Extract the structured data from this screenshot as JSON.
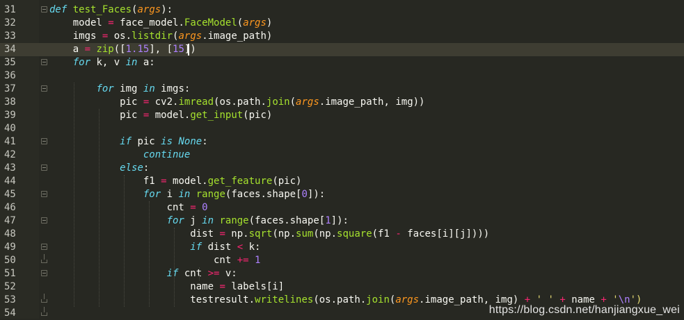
{
  "editor": {
    "theme_colors": {
      "background": "#272822",
      "current_line": "#3e3d32",
      "keyword": "#66d9ef",
      "function": "#a6e22e",
      "argument": "#fd971f",
      "number": "#ae81ff",
      "operator": "#f92672",
      "string": "#e6db74"
    },
    "lines": [
      {
        "n": "31",
        "segs": [
          [
            "kw",
            "def"
          ],
          [
            "t",
            " "
          ],
          [
            "fn",
            "test_Faces"
          ],
          [
            "t",
            "("
          ],
          [
            "arg",
            "args"
          ],
          [
            "t",
            "):"
          ]
        ]
      },
      {
        "n": "32",
        "segs": [
          [
            "t",
            "    model "
          ],
          [
            "op",
            "="
          ],
          [
            "t",
            " face_model."
          ],
          [
            "fn",
            "FaceModel"
          ],
          [
            "t",
            "("
          ],
          [
            "arg",
            "args"
          ],
          [
            "t",
            ")"
          ]
        ]
      },
      {
        "n": "33",
        "segs": [
          [
            "t",
            "    imgs "
          ],
          [
            "op",
            "="
          ],
          [
            "t",
            " os."
          ],
          [
            "fn",
            "listdir"
          ],
          [
            "t",
            "("
          ],
          [
            "arg",
            "args"
          ],
          [
            "t",
            ".image_path)"
          ]
        ]
      },
      {
        "n": "34",
        "segs": [
          [
            "t",
            "    a "
          ],
          [
            "op",
            "="
          ],
          [
            "t",
            " "
          ],
          [
            "fn",
            "zip"
          ],
          [
            "t",
            "(["
          ],
          [
            "num",
            "1.15"
          ],
          [
            "t",
            "], ["
          ],
          [
            "num",
            "15"
          ],
          [
            "t",
            "])"
          ]
        ]
      },
      {
        "n": "35",
        "segs": [
          [
            "t",
            "    "
          ],
          [
            "kw",
            "for"
          ],
          [
            "t",
            " k, v "
          ],
          [
            "kw",
            "in"
          ],
          [
            "t",
            " a:"
          ]
        ]
      },
      {
        "n": "36",
        "segs": []
      },
      {
        "n": "37",
        "segs": [
          [
            "t",
            "        "
          ],
          [
            "kw",
            "for"
          ],
          [
            "t",
            " img "
          ],
          [
            "kw",
            "in"
          ],
          [
            "t",
            " imgs:"
          ]
        ]
      },
      {
        "n": "38",
        "segs": [
          [
            "t",
            "            pic "
          ],
          [
            "op",
            "="
          ],
          [
            "t",
            " cv2."
          ],
          [
            "fn",
            "imread"
          ],
          [
            "t",
            "(os.path."
          ],
          [
            "fn",
            "join"
          ],
          [
            "t",
            "("
          ],
          [
            "arg",
            "args"
          ],
          [
            "t",
            ".image_path, img))"
          ]
        ]
      },
      {
        "n": "39",
        "segs": [
          [
            "t",
            "            pic "
          ],
          [
            "op",
            "="
          ],
          [
            "t",
            " model."
          ],
          [
            "fn",
            "get_input"
          ],
          [
            "t",
            "(pic)"
          ]
        ]
      },
      {
        "n": "40",
        "segs": []
      },
      {
        "n": "41",
        "segs": [
          [
            "t",
            "            "
          ],
          [
            "kw",
            "if"
          ],
          [
            "t",
            " pic "
          ],
          [
            "kw",
            "is"
          ],
          [
            "t",
            " "
          ],
          [
            "kw",
            "None"
          ],
          [
            "t",
            ":"
          ]
        ]
      },
      {
        "n": "42",
        "segs": [
          [
            "t",
            "                "
          ],
          [
            "kw",
            "continue"
          ]
        ]
      },
      {
        "n": "43",
        "segs": [
          [
            "t",
            "            "
          ],
          [
            "kw",
            "else"
          ],
          [
            "t",
            ":"
          ]
        ]
      },
      {
        "n": "44",
        "segs": [
          [
            "t",
            "                f1 "
          ],
          [
            "op",
            "="
          ],
          [
            "t",
            " model."
          ],
          [
            "fn",
            "get_feature"
          ],
          [
            "t",
            "(pic)"
          ]
        ]
      },
      {
        "n": "45",
        "segs": [
          [
            "t",
            "                "
          ],
          [
            "kw",
            "for"
          ],
          [
            "t",
            " i "
          ],
          [
            "kw",
            "in"
          ],
          [
            "t",
            " "
          ],
          [
            "fn",
            "range"
          ],
          [
            "t",
            "(faces.shape["
          ],
          [
            "num",
            "0"
          ],
          [
            "t",
            "]):"
          ]
        ]
      },
      {
        "n": "46",
        "segs": [
          [
            "t",
            "                    cnt "
          ],
          [
            "op",
            "="
          ],
          [
            "t",
            " "
          ],
          [
            "num",
            "0"
          ]
        ]
      },
      {
        "n": "47",
        "segs": [
          [
            "t",
            "                    "
          ],
          [
            "kw",
            "for"
          ],
          [
            "t",
            " j "
          ],
          [
            "kw",
            "in"
          ],
          [
            "t",
            " "
          ],
          [
            "fn",
            "range"
          ],
          [
            "t",
            "(faces.shape["
          ],
          [
            "num",
            "1"
          ],
          [
            "t",
            "]):"
          ]
        ]
      },
      {
        "n": "48",
        "segs": [
          [
            "t",
            "                        dist "
          ],
          [
            "op",
            "="
          ],
          [
            "t",
            " np."
          ],
          [
            "fn",
            "sqrt"
          ],
          [
            "t",
            "(np."
          ],
          [
            "fn",
            "sum"
          ],
          [
            "t",
            "(np."
          ],
          [
            "fn",
            "square"
          ],
          [
            "t",
            "(f1 "
          ],
          [
            "op",
            "-"
          ],
          [
            "t",
            " faces[i][j])))"
          ]
        ]
      },
      {
        "n": "49",
        "segs": [
          [
            "t",
            "                        "
          ],
          [
            "kw",
            "if"
          ],
          [
            "t",
            " dist "
          ],
          [
            "op",
            "<"
          ],
          [
            "t",
            " k:"
          ]
        ]
      },
      {
        "n": "50",
        "segs": [
          [
            "t",
            "                            cnt "
          ],
          [
            "op",
            "+="
          ],
          [
            "t",
            " "
          ],
          [
            "num",
            "1"
          ]
        ]
      },
      {
        "n": "51",
        "segs": [
          [
            "t",
            "                    "
          ],
          [
            "kw",
            "if"
          ],
          [
            "t",
            " cnt "
          ],
          [
            "op",
            ">="
          ],
          [
            "t",
            " v:"
          ]
        ]
      },
      {
        "n": "52",
        "segs": [
          [
            "t",
            "                        name "
          ],
          [
            "op",
            "="
          ],
          [
            "t",
            " labels[i]"
          ]
        ]
      },
      {
        "n": "53",
        "segs": [
          [
            "t",
            "                        testresult."
          ],
          [
            "fn",
            "writelines"
          ],
          [
            "t",
            "(os.path."
          ],
          [
            "fn",
            "join"
          ],
          [
            "t",
            "("
          ],
          [
            "arg",
            "args"
          ],
          [
            "t",
            ".image_path, img) "
          ],
          [
            "op",
            "+"
          ],
          [
            "t",
            " "
          ],
          [
            "str",
            "' '"
          ],
          [
            "t",
            " "
          ],
          [
            "op",
            "+"
          ],
          [
            "t",
            " name "
          ],
          [
            "op",
            "+"
          ],
          [
            "t",
            " "
          ],
          [
            "str",
            "'"
          ],
          [
            "esc",
            "\\n"
          ],
          [
            "str",
            "')"
          ]
        ]
      },
      {
        "n": "54",
        "segs": []
      }
    ],
    "folds": {
      "31": "box",
      "35": "box",
      "37": "box",
      "41": "box",
      "43": "box",
      "45": "box",
      "47": "box",
      "49": "box",
      "50": "end",
      "51": "box",
      "53": "end",
      "54": "end"
    },
    "current_line": "34"
  },
  "watermark": "https://blog.csdn.net/hanjiangxue_wei"
}
